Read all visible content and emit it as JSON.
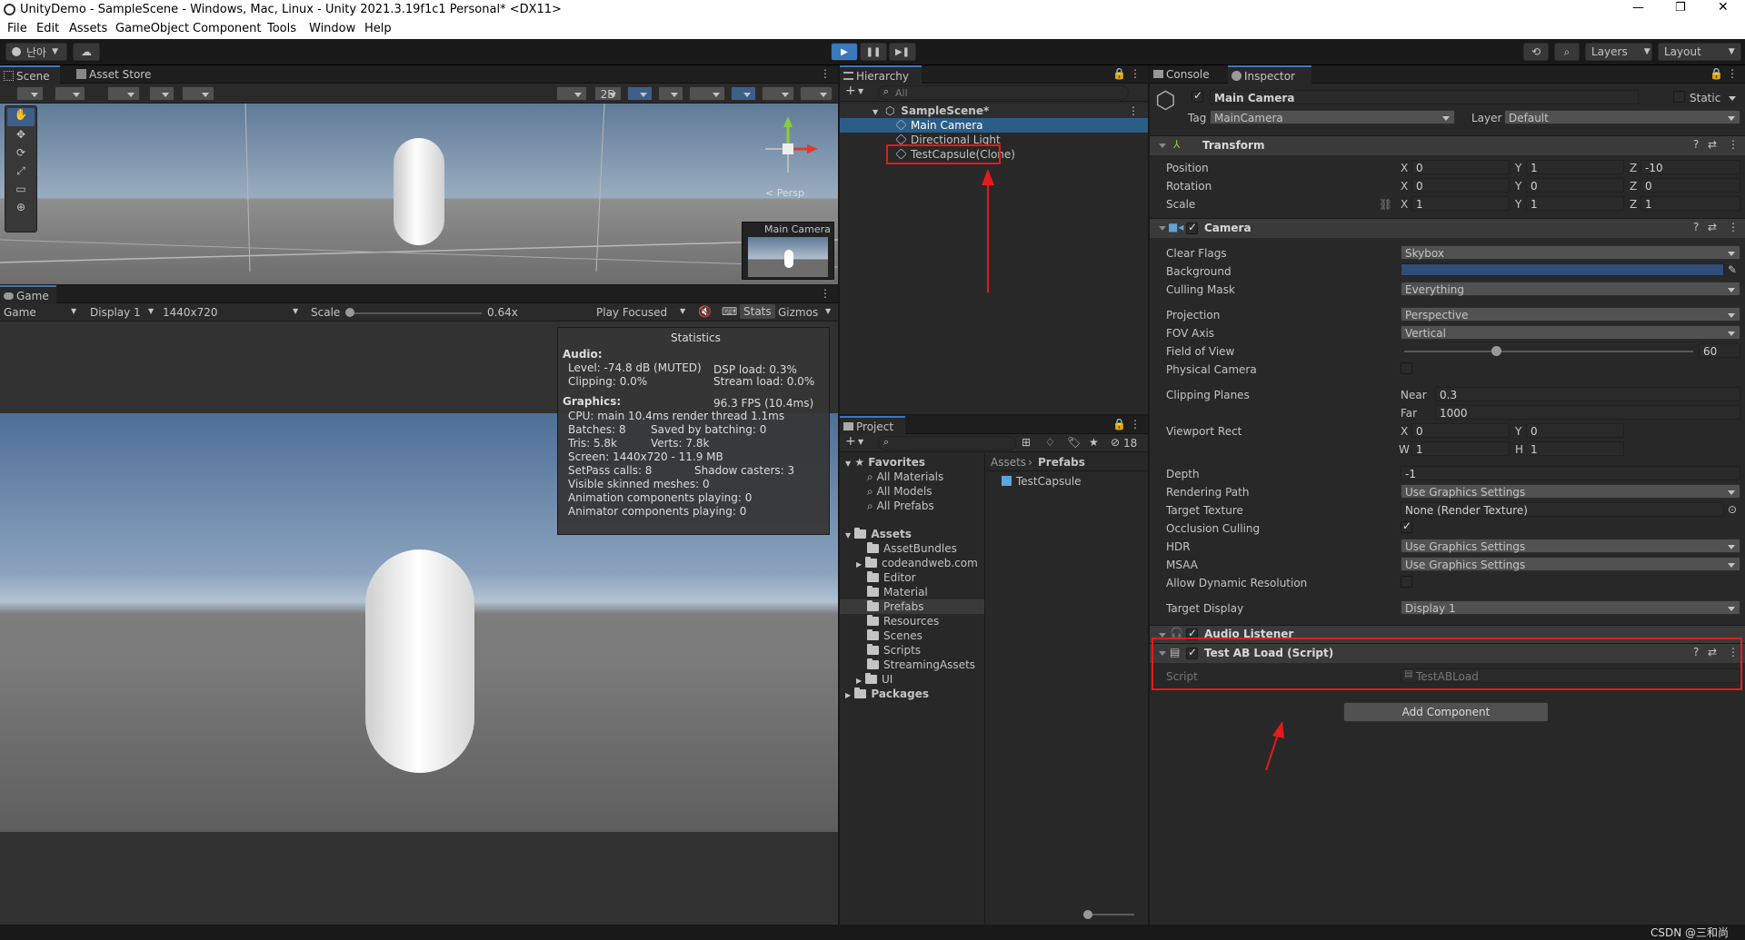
{
  "window": {
    "title": "UnityDemo - SampleScene - Windows, Mac, Linux - Unity 2021.3.19f1c1 Personal* <DX11>"
  },
  "menu": [
    "File",
    "Edit",
    "Assets",
    "GameObject",
    "Component",
    "Tools",
    "Window",
    "Help"
  ],
  "toolbar": {
    "account": "난아",
    "layers": "Layers",
    "layout": "Layout"
  },
  "scene_panel": {
    "tabs": [
      "Scene",
      "Asset Store"
    ],
    "mode_2d": "2D",
    "persp_label": "< Persp",
    "camera_preview_title": "Main Camera"
  },
  "game_panel": {
    "tab": "Game",
    "display_mode": "Game",
    "display": "Display 1",
    "resolution": "1440x720",
    "scale_label": "Scale",
    "scale_value": "0.64x",
    "play_focused": "Play Focused",
    "stats_label": "Stats",
    "gizmos_label": "Gizmos"
  },
  "statistics": {
    "title": "Statistics",
    "audio_header": "Audio:",
    "level": "Level: -74.8 dB (MUTED)",
    "clipping": "Clipping: 0.0%",
    "dsp_load": "DSP load: 0.3%",
    "stream_load": "Stream load: 0.0%",
    "graphics_header": "Graphics:",
    "fps": "96.3 FPS (10.4ms)",
    "cpu": "CPU: main 10.4ms  render thread 1.1ms",
    "batches": "Batches: 8",
    "saved_batching": "Saved by batching: 0",
    "tris": "Tris: 5.8k",
    "verts": "Verts: 7.8k",
    "screen": "Screen: 1440x720 - 11.9 MB",
    "setpass": "SetPass calls: 8",
    "shadow_casters": "Shadow casters: 3",
    "skinned_meshes": "Visible skinned meshes: 0",
    "animation_components": "Animation components playing: 0",
    "animator_components": "Animator components playing: 0"
  },
  "hierarchy": {
    "tab": "Hierarchy",
    "search_placeholder": "All",
    "scene": "SampleScene*",
    "items": [
      "Main Camera",
      "Directional Light",
      "TestCapsule(Clone)"
    ]
  },
  "project": {
    "tab": "Project",
    "count": "18",
    "favorites_label": "Favorites",
    "favorites": [
      "All Materials",
      "All Models",
      "All Prefabs"
    ],
    "assets_label": "Assets",
    "assets": [
      "AssetBundles",
      "codeandweb.com",
      "Editor",
      "Material",
      "Prefabs",
      "Resources",
      "Scenes",
      "Scripts",
      "StreamingAssets",
      "UI"
    ],
    "packages_label": "Packages",
    "breadcrumb": [
      "Assets",
      "Prefabs"
    ],
    "files": [
      "TestCapsule"
    ]
  },
  "inspector": {
    "tabs": [
      "Console",
      "Inspector"
    ],
    "object_name": "Main Camera",
    "static_label": "Static",
    "tag_label": "Tag",
    "tag_value": "MainCamera",
    "layer_label": "Layer",
    "layer_value": "Default",
    "transform": {
      "title": "Transform",
      "position_label": "Position",
      "position": [
        "0",
        "1",
        "-10"
      ],
      "rotation_label": "Rotation",
      "rotation": [
        "0",
        "0",
        "0"
      ],
      "scale_label": "Scale",
      "scale": [
        "1",
        "1",
        "1"
      ],
      "axes": [
        "X",
        "Y",
        "Z"
      ]
    },
    "camera": {
      "title": "Camera",
      "clear_flags_label": "Clear Flags",
      "clear_flags": "Skybox",
      "background_label": "Background",
      "background_color": "#314d79",
      "culling_mask_label": "Culling Mask",
      "culling_mask": "Everything",
      "projection_label": "Projection",
      "projection": "Perspective",
      "fov_axis_label": "FOV Axis",
      "fov_axis": "Vertical",
      "fov_label": "Field of View",
      "fov": "60",
      "physical_camera_label": "Physical Camera",
      "clipping_label": "Clipping Planes",
      "near_label": "Near",
      "near": "0.3",
      "far_label": "Far",
      "far": "1000",
      "viewport_label": "Viewport Rect",
      "vx": "0",
      "vy": "0",
      "vw": "1",
      "vh": "1",
      "depth_label": "Depth",
      "depth": "-1",
      "rendering_path_label": "Rendering Path",
      "rendering_path": "Use Graphics Settings",
      "target_texture_label": "Target Texture",
      "target_texture": "None (Render Texture)",
      "occlusion_label": "Occlusion Culling",
      "hdr_label": "HDR",
      "hdr": "Use Graphics Settings",
      "msaa_label": "MSAA",
      "msaa": "Use Graphics Settings",
      "dynamic_res_label": "Allow Dynamic Resolution",
      "target_display_label": "Target Display",
      "target_display": "Display 1"
    },
    "audio_listener": "Audio Listener",
    "script_component": {
      "title": "Test AB Load (Script)",
      "script_label": "Script",
      "script_value": "TestABLoad"
    },
    "add_component": "Add Component"
  },
  "watermark": "CSDN @三和尚"
}
